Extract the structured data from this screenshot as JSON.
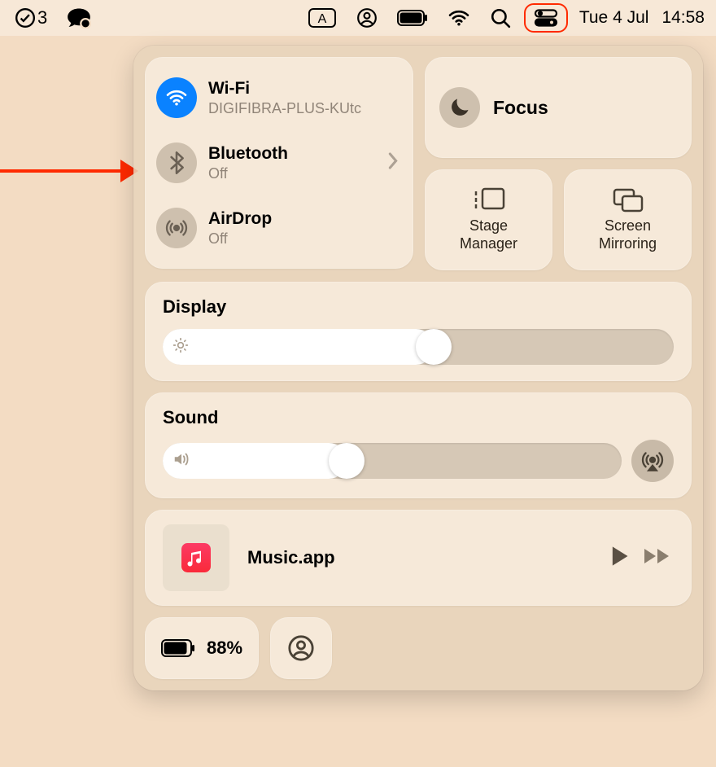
{
  "menubar": {
    "todo_count": "3",
    "date": "Tue 4 Jul",
    "time": "14:58"
  },
  "connectivity": {
    "wifi": {
      "title": "Wi-Fi",
      "sub": "DIGIFIBRA-PLUS-KUtc"
    },
    "bluetooth": {
      "title": "Bluetooth",
      "sub": "Off"
    },
    "airdrop": {
      "title": "AirDrop",
      "sub": "Off"
    }
  },
  "focus": {
    "label": "Focus"
  },
  "stage_manager": {
    "label": "Stage Manager"
  },
  "screen_mirroring": {
    "label": "Screen Mirroring"
  },
  "display": {
    "title": "Display",
    "value_pct": 53
  },
  "sound": {
    "title": "Sound",
    "value_pct": 36
  },
  "music": {
    "title": "Music.app"
  },
  "battery": {
    "pct": "88%"
  }
}
